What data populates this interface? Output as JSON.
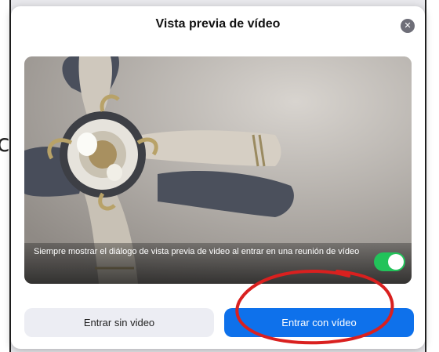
{
  "dialog": {
    "title": "Vista previa de vídeo",
    "close_icon": "close-icon"
  },
  "preview": {
    "always_show_text": "Siempre mostrar el diálogo de vista previa de video al entrar en una reunión de vídeo",
    "toggle_on": true
  },
  "buttons": {
    "join_without_video": "Entrar sin video",
    "join_with_video": "Entrar con vídeo"
  },
  "colors": {
    "primary": "#0e71eb",
    "toggle_on": "#22c35a",
    "annotation": "#d9201f"
  }
}
